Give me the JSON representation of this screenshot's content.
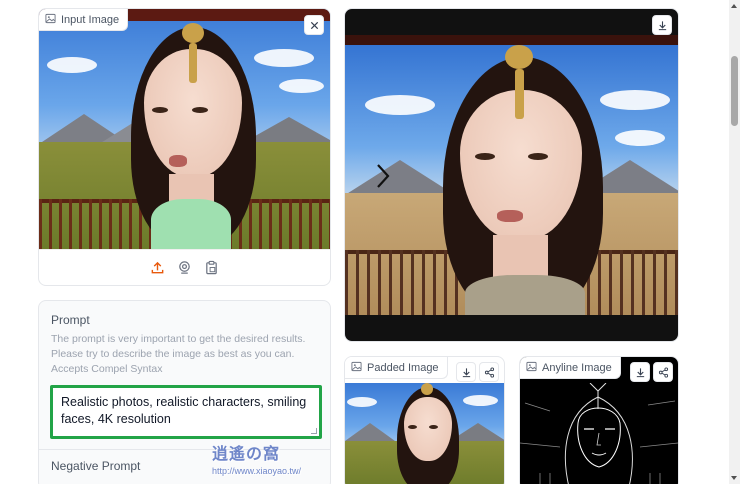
{
  "input_panel": {
    "label": "Input Image",
    "icons": [
      "image-icon",
      "close-icon",
      "upload-icon",
      "webcam-icon",
      "clipboard-icon"
    ]
  },
  "output_panel": {
    "icons": [
      "download-icon",
      "chevron-right-icon"
    ]
  },
  "padded_panel": {
    "label": "Padded Image",
    "icons": [
      "image-icon",
      "download-icon",
      "share-icon"
    ]
  },
  "anyline_panel": {
    "label": "Anyline Image",
    "icons": [
      "image-icon",
      "download-icon",
      "share-icon"
    ]
  },
  "prompt": {
    "label": "Prompt",
    "description": "The prompt is very important to get the desired results. Please try to describe the image as best as you can. Accepts Compel Syntax",
    "value": "Realistic photos, realistic characters, smiling faces, 4K resolution"
  },
  "negative_prompt": {
    "label": "Negative Prompt"
  },
  "watermark": {
    "text": "逍遙の窩",
    "url": "http://www.xiaoyao.tw/"
  },
  "colors": {
    "accent_green": "#22a447",
    "upload_orange": "#e8590c"
  }
}
